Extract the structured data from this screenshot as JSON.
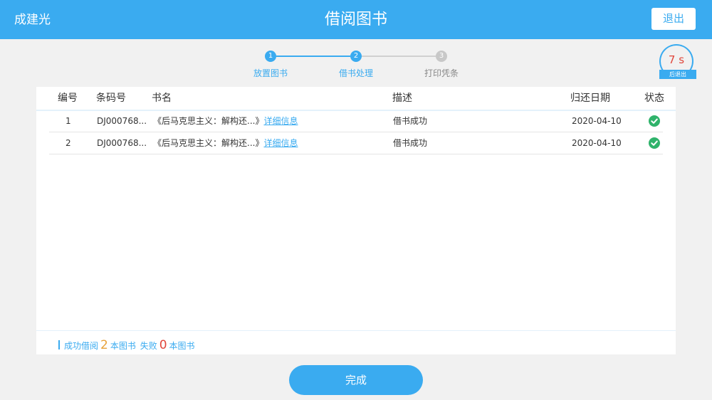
{
  "header": {
    "user_name": "成建光",
    "title": "借阅图书",
    "logout_label": "退出"
  },
  "steps": [
    {
      "num": "1",
      "label": "放置图书",
      "state": "done"
    },
    {
      "num": "2",
      "label": "借书处理",
      "state": "active"
    },
    {
      "num": "3",
      "label": "打印凭条",
      "state": "pending"
    }
  ],
  "countdown": {
    "value": "7 s",
    "suffix": "后退出"
  },
  "table": {
    "columns": [
      "编号",
      "条码号",
      "书名",
      "描述",
      "归还日期",
      "状态"
    ],
    "rows": [
      {
        "no": "1",
        "barcode": "DJ000768...",
        "title": "《后马克思主义：解构还...》",
        "detail": "详细信息",
        "desc": "借书成功",
        "due": "2020-04-10",
        "status_icon": "check-circle-icon"
      },
      {
        "no": "2",
        "barcode": "DJ000768...",
        "title": "《后马克思主义：解构还...》",
        "detail": "详细信息",
        "desc": "借书成功",
        "due": "2020-04-10",
        "status_icon": "check-circle-icon"
      }
    ]
  },
  "summary": {
    "success_prefix": "成功借阅",
    "success_count": "2",
    "success_suffix": "本图书",
    "fail_prefix": "失败",
    "fail_count": "0",
    "fail_suffix": "本图书"
  },
  "finish_label": "完成",
  "colors": {
    "primary": "#3aabf0",
    "success": "#2fb36b",
    "success_count": "#e8a23a",
    "fail_count": "#e0463b",
    "pending": "#c8c8c8"
  }
}
